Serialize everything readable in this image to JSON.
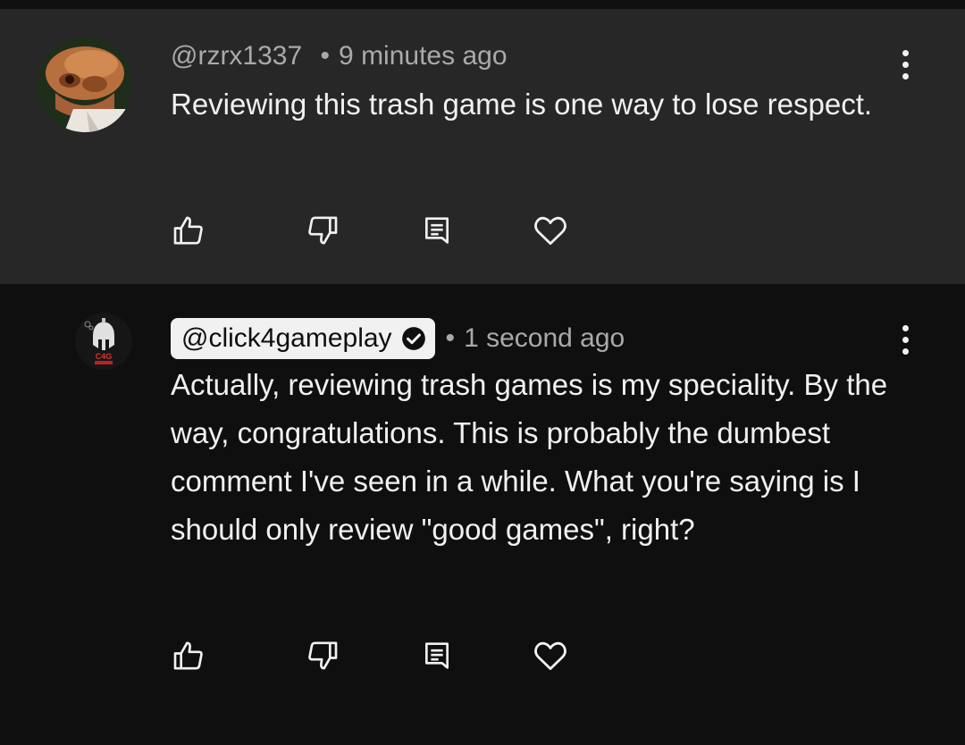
{
  "comments": [
    {
      "handle": "@rzrx1337",
      "separator": "•",
      "time": "9 minutes ago",
      "text": "Reviewing this trash game is one way to lose respect.",
      "verified": false,
      "highlighted": false,
      "avatar_icon": "alien-character-avatar"
    },
    {
      "handle": "@click4gameplay",
      "separator": "•",
      "time": "1 second ago",
      "text": "Actually, reviewing trash games is my speciality. By the way, congratulations. This is probably the dumbest comment I've seen in a while. What you're saying is I should only review \"good games\", right?",
      "verified": true,
      "highlighted": true,
      "avatar_icon": "spartan-helmet-avatar",
      "avatar_label": "C4G"
    }
  ],
  "actions": [
    "like-icon",
    "dislike-icon",
    "reply-icon",
    "heart-icon"
  ],
  "colors": {
    "background": "#0f0f0f",
    "highlighted_comment_bg": "#272727",
    "primary_text": "#f1f1f1",
    "secondary_text": "#aaaaaa",
    "chip_bg": "#f1f1f1"
  }
}
